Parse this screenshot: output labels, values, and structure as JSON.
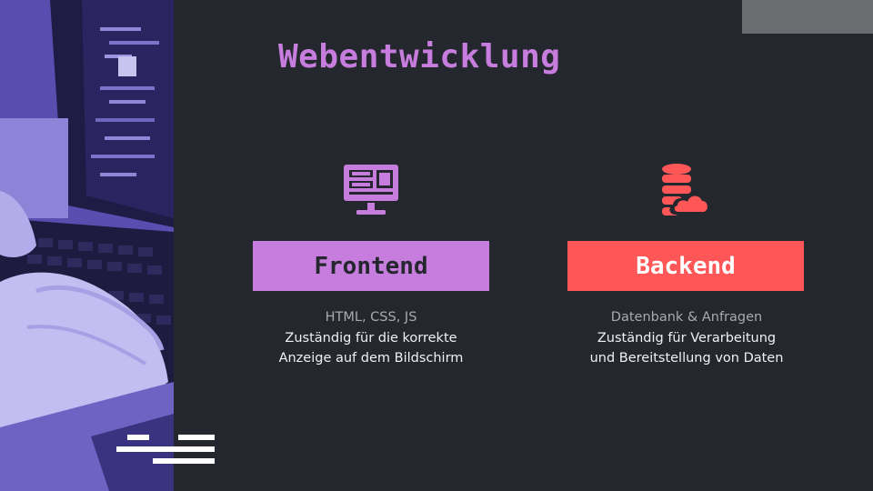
{
  "title": "Webentwicklung",
  "frontend": {
    "icon": "monitor-icon",
    "label": "Frontend",
    "technologies": "HTML, CSS, JS",
    "description_line1": "Zuständig für die korrekte",
    "description_line2": "Anzeige auf dem Bildschirm",
    "color": "#c77ddd"
  },
  "backend": {
    "icon": "database-cloud-icon",
    "label": "Backend",
    "technologies": "Datenbank & Anfragen",
    "description_line1": "Zuständig für Verarbeitung",
    "description_line2": "und Bereitstellung von Daten",
    "color": "#ff5757"
  },
  "colors": {
    "background": "#25272e",
    "accent_purple": "#c77ddd",
    "accent_red": "#ff5757",
    "photo_tint": "#5b4fb0"
  }
}
